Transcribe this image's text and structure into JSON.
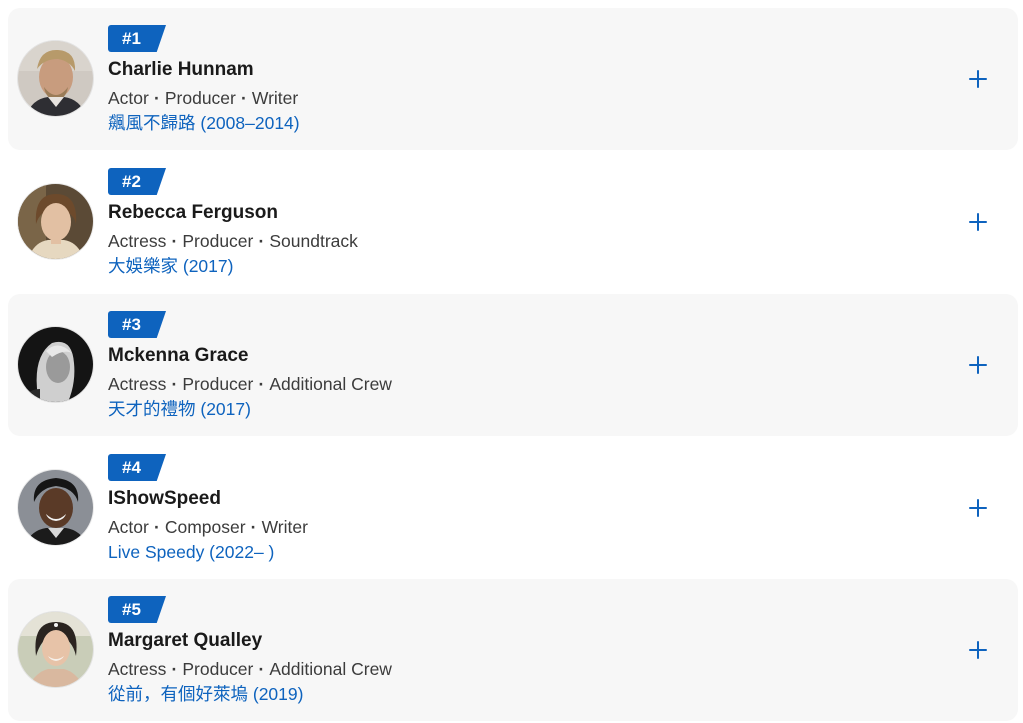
{
  "people": [
    {
      "rank": "#1",
      "name": "Charlie Hunnam",
      "roles": [
        "Actor",
        "Producer",
        "Writer"
      ],
      "known_for": "飆風不歸路 (2008–2014)",
      "avatar_icon": "person-photo-charlie-hunnam"
    },
    {
      "rank": "#2",
      "name": "Rebecca Ferguson",
      "roles": [
        "Actress",
        "Producer",
        "Soundtrack"
      ],
      "known_for": "大娛樂家 (2017)",
      "avatar_icon": "person-photo-rebecca-ferguson"
    },
    {
      "rank": "#3",
      "name": "Mckenna Grace",
      "roles": [
        "Actress",
        "Producer",
        "Additional Crew"
      ],
      "known_for": "天才的禮物 (2017)",
      "avatar_icon": "person-photo-mckenna-grace"
    },
    {
      "rank": "#4",
      "name": "IShowSpeed",
      "roles": [
        "Actor",
        "Composer",
        "Writer"
      ],
      "known_for": "Live Speedy (2022– )",
      "avatar_icon": "person-photo-ishowspeed"
    },
    {
      "rank": "#5",
      "name": "Margaret Qualley",
      "roles": [
        "Actress",
        "Producer",
        "Additional Crew"
      ],
      "known_for": "從前，有個好萊塢 (2019)",
      "avatar_icon": "person-photo-margaret-qualley"
    }
  ],
  "add_icon": "plus-icon",
  "colors": {
    "accent": "#0e63be",
    "row_shade": "#f7f7f7",
    "text_primary": "#1a1a1a",
    "text_secondary": "#3c3c3c"
  }
}
